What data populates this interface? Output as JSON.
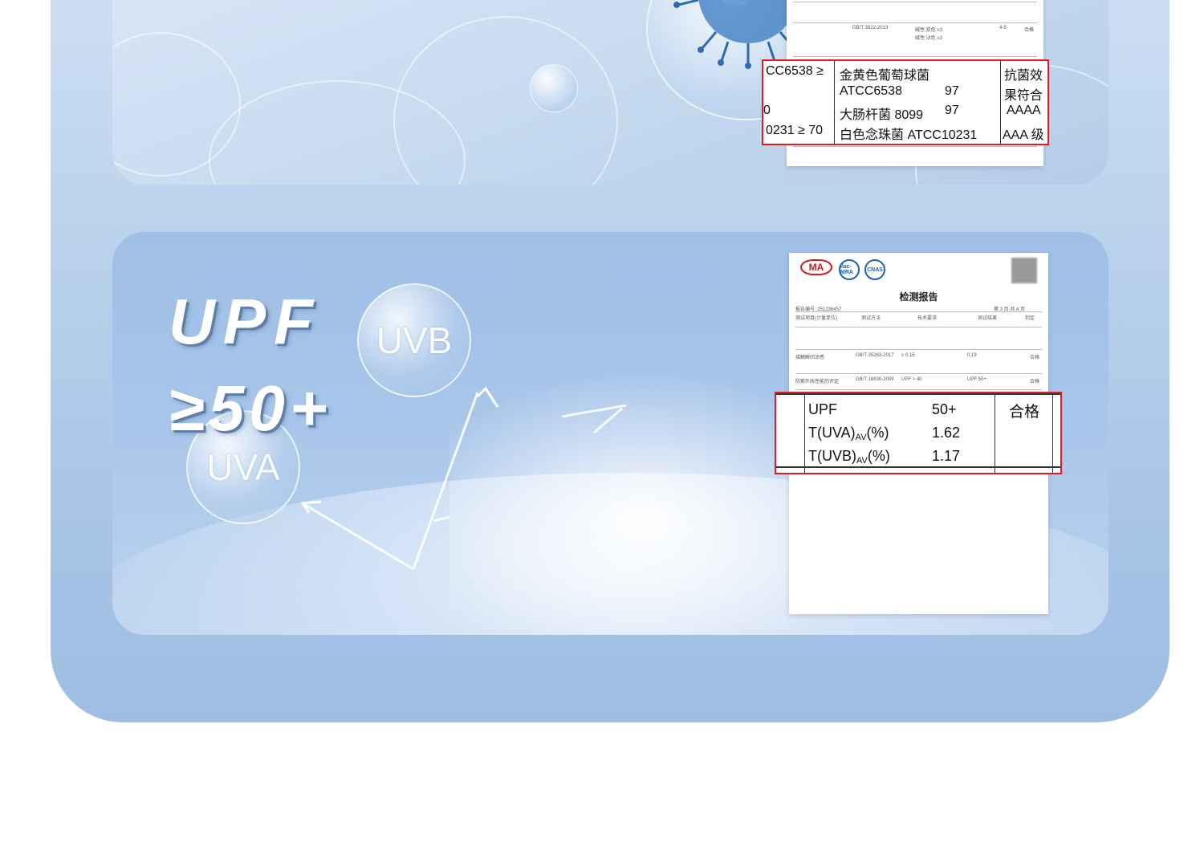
{
  "top_panel": {
    "zoom_rows": [
      {
        "left": "CC6538 ≥",
        "mid": "金黄色葡萄球菌",
        "right": "抗菌效"
      },
      {
        "left": "",
        "mid": "ATCC6538",
        "val": "97",
        "right": "果符合"
      },
      {
        "left": "0",
        "mid": "大肠杆菌 8099",
        "val": "97",
        "right": "AAAA"
      },
      {
        "left": "0231 ≥ 70",
        "mid": "白色念珠菌 ATCC10231",
        "right": "AAA 级"
      }
    ],
    "mini_text": [
      "GB/T 3922-2013",
      "碱性:变色 ≥3",
      "碱性:沾色 ≥3",
      "4-5",
      "合格"
    ]
  },
  "bottom_panel": {
    "headline_line1": "UPF",
    "headline_line2": "≥50+",
    "bubble_uvb": "UVB",
    "bubble_uva": "UVA",
    "report": {
      "logo_cma": "MA",
      "logo_ilac": "ilac-MRA",
      "logo_cnas": "CNAS",
      "title": "检测报告",
      "meta_left": "报告编号: 251236457",
      "meta_right": "第 3 页 共 4 页",
      "col_headers": [
        "测试项目(计量单位)",
        "测试方法",
        "技术要求",
        "测试结果",
        "判定"
      ],
      "rows": [
        {
          "item": "接触瞬间凉感",
          "method": "GB/T 35263-2017",
          "req": "≥ 0.15",
          "result": "0.19",
          "verdict": "合格"
        },
        {
          "item": "防紫外线性能的评定",
          "method": "GB/T 18830-2009",
          "req": "UPF > 40",
          "result": "UPF 50+",
          "verdict": "合格"
        }
      ]
    },
    "zoom": {
      "label_upf": "UPF",
      "value_upf": "50+",
      "label_uva_pre": "T(UVA)",
      "label_uva_sub": "AV",
      "label_uva_post": "(%)",
      "value_uva": "1.62",
      "label_uvb_pre": "T(UVB)",
      "label_uvb_sub": "AV",
      "label_uvb_post": "(%)",
      "value_uvb": "1.17",
      "verdict": "合格"
    }
  },
  "colors": {
    "accent_red": "#e01b24",
    "panel_blue": "#a7c4e6",
    "title_shadow": "#5f7fa8"
  }
}
